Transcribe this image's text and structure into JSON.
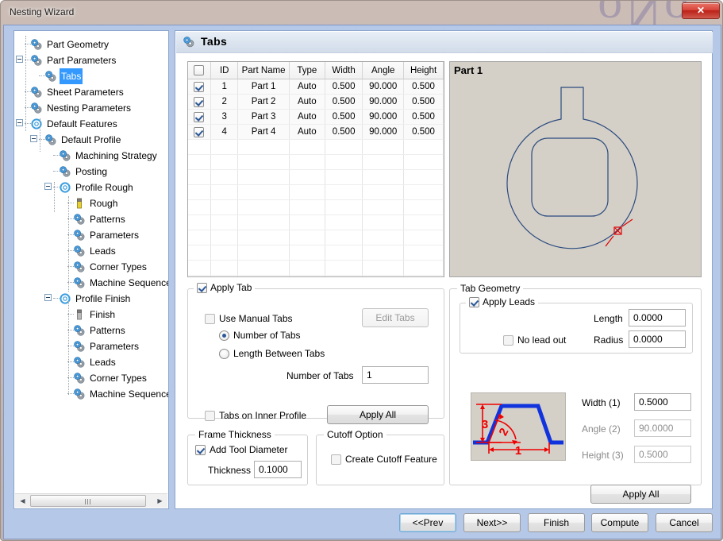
{
  "window": {
    "title": "Nesting Wizard",
    "close_label": "✕",
    "bleed_text": "oNo"
  },
  "tree": {
    "items": [
      {
        "label": "Part Geometry",
        "depth": 1,
        "icon": "gear-pair-icon",
        "twisty": "none",
        "selected": false
      },
      {
        "label": "Part Parameters",
        "depth": 1,
        "icon": "gear-pair-icon",
        "twisty": "collapse",
        "selected": false
      },
      {
        "label": "Tabs",
        "depth": 2,
        "icon": "gear-pair-icon",
        "twisty": "none",
        "selected": true
      },
      {
        "label": "Sheet Parameters",
        "depth": 1,
        "icon": "gear-pair-icon",
        "twisty": "none",
        "selected": false
      },
      {
        "label": "Nesting Parameters",
        "depth": 1,
        "icon": "gear-pair-icon",
        "twisty": "none",
        "selected": false
      },
      {
        "label": "Default Features",
        "depth": 1,
        "icon": "gear-open-icon",
        "twisty": "collapse",
        "selected": false
      },
      {
        "label": "Default Profile",
        "depth": 2,
        "icon": "gear-pair-icon",
        "twisty": "collapse",
        "selected": false
      },
      {
        "label": "Machining Strategy",
        "depth": 3,
        "icon": "gear-pair-icon",
        "twisty": "none",
        "selected": false
      },
      {
        "label": "Posting",
        "depth": 3,
        "icon": "gear-pair-icon",
        "twisty": "none",
        "selected": false
      },
      {
        "label": "Profile Rough",
        "depth": 3,
        "icon": "gear-open-icon",
        "twisty": "collapse",
        "selected": false
      },
      {
        "label": "Rough",
        "depth": 4,
        "icon": "tool-yellow-icon",
        "twisty": "none",
        "selected": false
      },
      {
        "label": "Patterns",
        "depth": 4,
        "icon": "gear-pair-icon",
        "twisty": "none",
        "selected": false
      },
      {
        "label": "Parameters",
        "depth": 4,
        "icon": "gear-pair-icon",
        "twisty": "none",
        "selected": false
      },
      {
        "label": "Leads",
        "depth": 4,
        "icon": "gear-pair-icon",
        "twisty": "none",
        "selected": false
      },
      {
        "label": "Corner Types",
        "depth": 4,
        "icon": "gear-pair-icon",
        "twisty": "none",
        "selected": false
      },
      {
        "label": "Machine Sequence",
        "depth": 4,
        "icon": "gear-pair-icon",
        "twisty": "none",
        "selected": false
      },
      {
        "label": "Profile Finish",
        "depth": 3,
        "icon": "gear-open-icon",
        "twisty": "collapse",
        "selected": false
      },
      {
        "label": "Finish",
        "depth": 4,
        "icon": "tool-gray-icon",
        "twisty": "none",
        "selected": false
      },
      {
        "label": "Patterns",
        "depth": 4,
        "icon": "gear-pair-icon",
        "twisty": "none",
        "selected": false
      },
      {
        "label": "Parameters",
        "depth": 4,
        "icon": "gear-pair-icon",
        "twisty": "none",
        "selected": false
      },
      {
        "label": "Leads",
        "depth": 4,
        "icon": "gear-pair-icon",
        "twisty": "none",
        "selected": false
      },
      {
        "label": "Corner Types",
        "depth": 4,
        "icon": "gear-pair-icon",
        "twisty": "none",
        "selected": false
      },
      {
        "label": "Machine Sequence",
        "depth": 4,
        "icon": "gear-pair-icon",
        "twisty": "none",
        "selected": false
      }
    ],
    "hscroll": {
      "left_arrow": "◀",
      "right_arrow": "▶"
    }
  },
  "page": {
    "title": "Tabs"
  },
  "parts_table": {
    "columns": [
      "",
      "ID",
      "Part Name",
      "Type",
      "Width",
      "Angle",
      "Height"
    ],
    "header_checkbox_checked": false,
    "rows": [
      {
        "checked": true,
        "id": "1",
        "name": "Part 1",
        "type": "Auto",
        "width": "0.500",
        "angle": "90.000",
        "height": "0.500"
      },
      {
        "checked": true,
        "id": "2",
        "name": "Part 2",
        "type": "Auto",
        "width": "0.500",
        "angle": "90.000",
        "height": "0.500"
      },
      {
        "checked": true,
        "id": "3",
        "name": "Part 3",
        "type": "Auto",
        "width": "0.500",
        "angle": "90.000",
        "height": "0.500"
      },
      {
        "checked": true,
        "id": "4",
        "name": "Part 4",
        "type": "Auto",
        "width": "0.500",
        "angle": "90.000",
        "height": "0.500"
      }
    ],
    "empty_rows": 10
  },
  "preview": {
    "label": "Part 1",
    "outline_color": "#2b4a7e",
    "marker_color": "#e00000",
    "background": "#d4d0c8"
  },
  "apply_tab": {
    "caption": "Apply Tab",
    "caption_checked": true,
    "use_manual_tabs": {
      "label": "Use Manual Tabs",
      "checked": false
    },
    "edit_tabs_button": {
      "label": "Edit Tabs",
      "enabled": false
    },
    "number_of_tabs_radio": {
      "label": "Number of Tabs",
      "selected": true
    },
    "length_between_tabs_radio": {
      "label": "Length Between Tabs",
      "selected": false
    },
    "number_of_tabs_field": {
      "label": "Number of Tabs",
      "value": "1"
    },
    "tabs_on_inner_profile": {
      "label": "Tabs on Inner Profile",
      "checked": false
    },
    "apply_all_button": {
      "label": "Apply All"
    }
  },
  "frame_thickness": {
    "caption": "Frame Thickness",
    "add_tool_diameter": {
      "label": "Add Tool Diameter",
      "checked": true
    },
    "thickness": {
      "label": "Thickness",
      "value": "0.1000"
    }
  },
  "cutoff_option": {
    "caption": "Cutoff Option",
    "create_cutoff_feature": {
      "label": "Create Cutoff Feature",
      "checked": false
    }
  },
  "tab_geometry": {
    "caption": "Tab Geometry",
    "apply_leads": {
      "caption": "Apply Leads",
      "checked": true
    },
    "no_lead_out": {
      "label": "No lead out",
      "checked": false
    },
    "length": {
      "label": "Length",
      "value": "0.0000"
    },
    "radius": {
      "label": "Radius",
      "value": "0.0000"
    },
    "width": {
      "label": "Width (1)",
      "value": "0.5000",
      "enabled": true
    },
    "angle": {
      "label": "Angle (2)",
      "value": "90.0000",
      "enabled": false
    },
    "height": {
      "label": "Height (3)",
      "value": "0.5000",
      "enabled": false
    },
    "apply_all_button": {
      "label": "Apply All"
    },
    "diagram": {
      "labels": [
        "1",
        "2",
        "3"
      ],
      "shape_color": "#1133dd",
      "dim_color": "#ee0000"
    }
  },
  "footer": {
    "buttons": [
      {
        "label": "<<Prev",
        "default": true
      },
      {
        "label": "Next>>",
        "default": false
      },
      {
        "label": "Finish",
        "default": false
      },
      {
        "label": "Compute",
        "default": false
      },
      {
        "label": "Cancel",
        "default": false
      }
    ]
  }
}
